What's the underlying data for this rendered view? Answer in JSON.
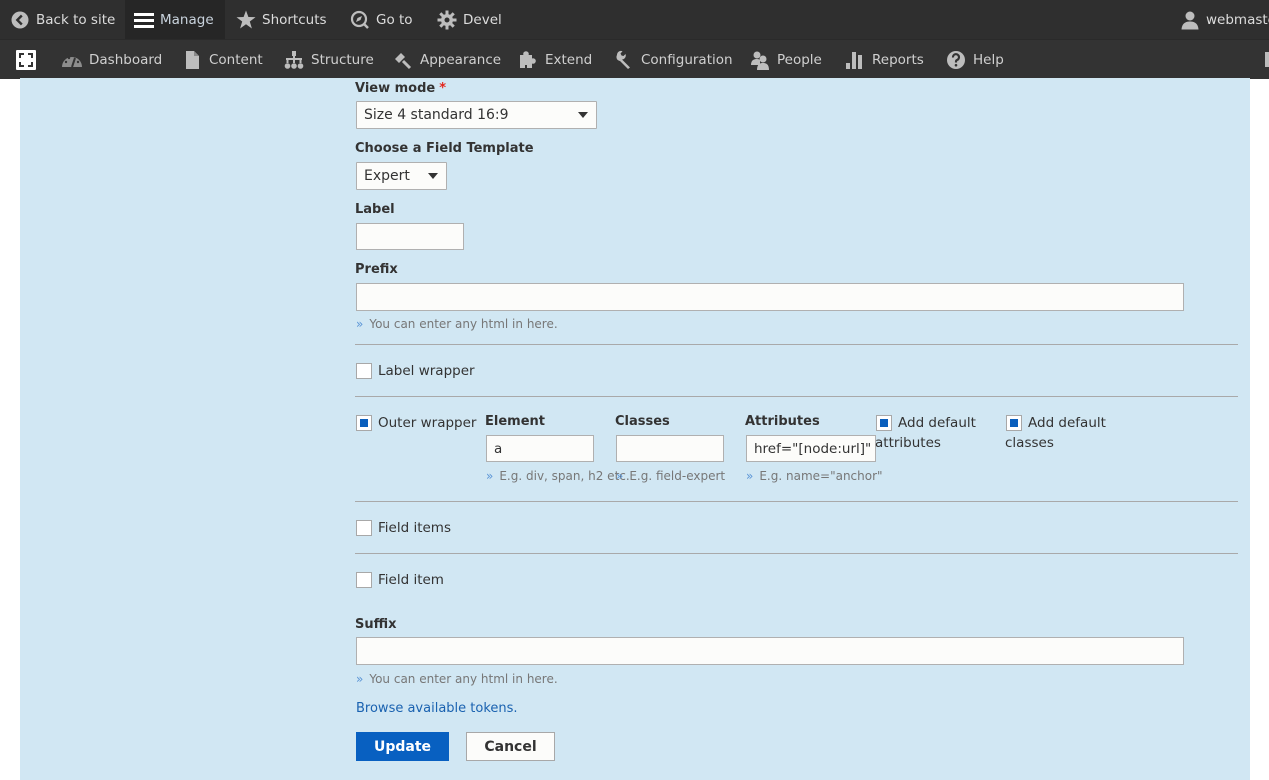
{
  "toolbar": {
    "back_to_site": "Back to site",
    "manage": "Manage",
    "shortcuts": "Shortcuts",
    "go_to": "Go to",
    "devel": "Devel",
    "user": "webmaste"
  },
  "admin_menu": {
    "items": [
      {
        "label": "Dashboard"
      },
      {
        "label": "Content"
      },
      {
        "label": "Structure"
      },
      {
        "label": "Appearance"
      },
      {
        "label": "Extend"
      },
      {
        "label": "Configuration"
      },
      {
        "label": "People"
      },
      {
        "label": "Reports"
      },
      {
        "label": "Help"
      }
    ]
  },
  "form": {
    "view_mode": {
      "label": "View mode",
      "required_mark": "*",
      "value": "Size 4 standard 16:9"
    },
    "field_template": {
      "label": "Choose a Field Template",
      "value": "Expert"
    },
    "label": {
      "label": "Label",
      "value": ""
    },
    "prefix": {
      "label": "Prefix",
      "value": "",
      "description": "You can enter any html in here."
    },
    "label_wrapper": {
      "label": "Label wrapper",
      "checked": false
    },
    "outer_wrapper": {
      "label": "Outer wrapper",
      "checked": true,
      "element": {
        "label": "Element",
        "value": "a",
        "description": "E.g. div, span, h2 etc."
      },
      "classes": {
        "label": "Classes",
        "value": "",
        "description": "E.g. field-expert"
      },
      "attributes": {
        "label": "Attributes",
        "value": "href=\"[node:url]\"",
        "description": "E.g. name=\"anchor\""
      },
      "add_default_attributes": {
        "label_line1": "Add default",
        "label_line2": "attributes",
        "checked": true
      },
      "add_default_classes": {
        "label_line1": "Add default",
        "label_line2": "classes",
        "checked": true
      }
    },
    "field_items": {
      "label": "Field items",
      "checked": false
    },
    "field_item": {
      "label": "Field item",
      "checked": false
    },
    "suffix": {
      "label": "Suffix",
      "value": "",
      "description": "You can enter any html in here."
    },
    "browse_tokens": "Browse available tokens.",
    "update_button": "Update",
    "cancel_button": "Cancel",
    "description_bullet": "»"
  },
  "colors": {
    "toolbar_bg": "#2f2f2f",
    "panel_bg": "#d1e7f3",
    "primary": "#0860c1",
    "link": "#1a62b0",
    "required": "#e3261c"
  }
}
